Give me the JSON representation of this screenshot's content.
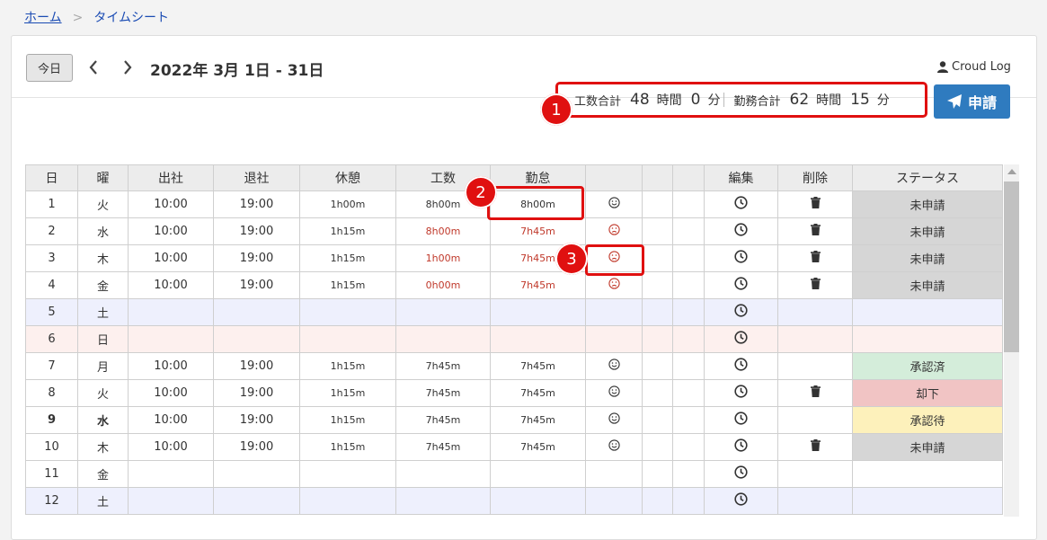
{
  "breadcrumb": {
    "home": "ホーム",
    "separator": ">",
    "current": "タイムシート"
  },
  "header": {
    "today_label": "今日",
    "date_range": "2022年 3月 1日 - 31日",
    "user_name": "Croud Log"
  },
  "summary": {
    "work_label": "工数合計",
    "work_hours": "48",
    "hour_unit": "時間",
    "work_minutes": "0",
    "min_unit": "分",
    "attend_label": "勤務合計",
    "attend_hours": "62",
    "attend_hour_unit": "時間",
    "attend_minutes": "15",
    "attend_min_unit": "分"
  },
  "apply_label": "申請",
  "badges": [
    "1",
    "2",
    "3"
  ],
  "table": {
    "headers": [
      "日",
      "曜",
      "出社",
      "退社",
      "休憩",
      "工数",
      "勤怠",
      "",
      "",
      "",
      "編集",
      "削除",
      "ステータス"
    ],
    "rows": [
      {
        "day": "1",
        "dow": "火",
        "in": "10:00",
        "out": "19:00",
        "break": "1h00m",
        "work": "8h00m",
        "attend": "8h00m",
        "face": "smile",
        "status": "未申請",
        "st": "none",
        "del": true
      },
      {
        "day": "2",
        "dow": "水",
        "in": "10:00",
        "out": "19:00",
        "break": "1h15m",
        "work": "8h00m",
        "attend": "7h45m",
        "face": "sad",
        "status": "未申請",
        "st": "none",
        "del": true,
        "redwork": true,
        "redattend": true
      },
      {
        "day": "3",
        "dow": "木",
        "in": "10:00",
        "out": "19:00",
        "break": "1h15m",
        "work": "1h00m",
        "attend": "7h45m",
        "face": "sad",
        "status": "未申請",
        "st": "none",
        "del": true,
        "redwork": true,
        "redattend": true
      },
      {
        "day": "4",
        "dow": "金",
        "in": "10:00",
        "out": "19:00",
        "break": "1h15m",
        "work": "0h00m",
        "attend": "7h45m",
        "face": "sad",
        "status": "未申請",
        "st": "none",
        "del": true,
        "redwork": true,
        "redattend": true
      },
      {
        "day": "5",
        "dow": "土",
        "in": "",
        "out": "",
        "break": "",
        "work": "",
        "attend": "",
        "face": "",
        "status": "",
        "st": "",
        "del": false,
        "row": "sat"
      },
      {
        "day": "6",
        "dow": "日",
        "in": "",
        "out": "",
        "break": "",
        "work": "",
        "attend": "",
        "face": "",
        "status": "",
        "st": "",
        "del": false,
        "row": "sun"
      },
      {
        "day": "7",
        "dow": "月",
        "in": "10:00",
        "out": "19:00",
        "break": "1h15m",
        "work": "7h45m",
        "attend": "7h45m",
        "face": "smile",
        "status": "承認済",
        "st": "ok",
        "del": false
      },
      {
        "day": "8",
        "dow": "火",
        "in": "10:00",
        "out": "19:00",
        "break": "1h15m",
        "work": "7h45m",
        "attend": "7h45m",
        "face": "smile",
        "status": "却下",
        "st": "ng",
        "del": true
      },
      {
        "day": "9",
        "dow": "水",
        "in": "10:00",
        "out": "19:00",
        "break": "1h15m",
        "work": "7h45m",
        "attend": "7h45m",
        "face": "smile",
        "status": "承認待",
        "st": "wait",
        "del": false,
        "bold": true
      },
      {
        "day": "10",
        "dow": "木",
        "in": "10:00",
        "out": "19:00",
        "break": "1h15m",
        "work": "7h45m",
        "attend": "7h45m",
        "face": "smile",
        "status": "未申請",
        "st": "none",
        "del": true
      },
      {
        "day": "11",
        "dow": "金",
        "in": "",
        "out": "",
        "break": "",
        "work": "",
        "attend": "",
        "face": "",
        "status": "",
        "st": "",
        "del": false
      },
      {
        "day": "12",
        "dow": "土",
        "in": "",
        "out": "",
        "break": "",
        "work": "",
        "attend": "",
        "face": "",
        "status": "",
        "st": "",
        "del": false,
        "row": "sat"
      }
    ]
  },
  "colors": {
    "accent": "#2f7bbf",
    "highlight": "#e01010",
    "red_text": "#c0392b"
  }
}
